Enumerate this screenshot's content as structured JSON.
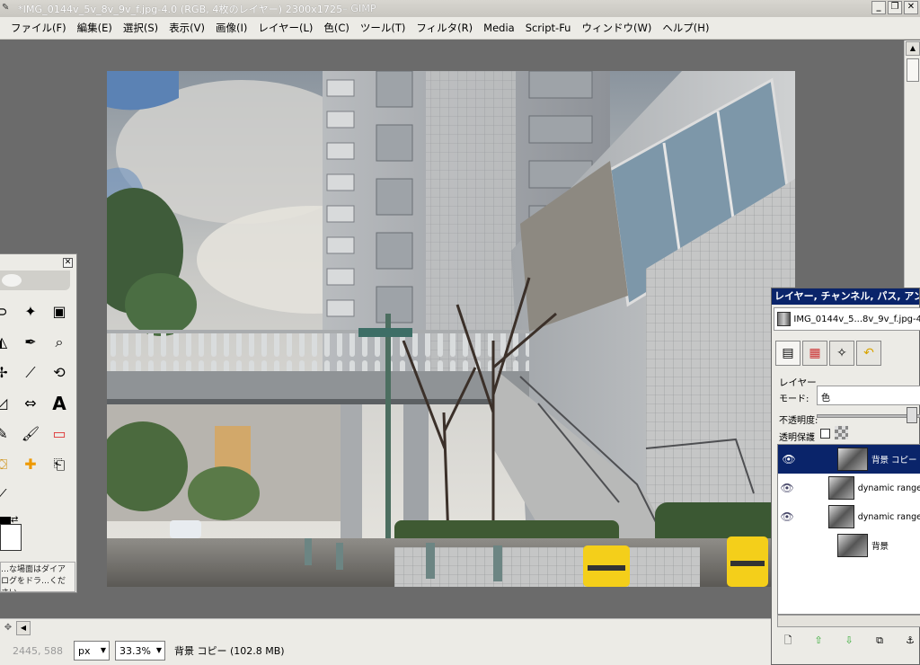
{
  "window": {
    "title_main": "*IMG_0144v_5v_8v_9v_f.jpg-4.0 (RGB, 4枚のレイヤー) 2300x1725",
    "title_suffix": " – GIMP",
    "buttons": {
      "minimize": "_",
      "maximize": "❐",
      "close": "✕"
    }
  },
  "menu": [
    "ファイル(F)",
    "編集(E)",
    "選択(S)",
    "表示(V)",
    "画像(I)",
    "レイヤー(L)",
    "色(C)",
    "ツール(T)",
    "フィルタ(R)",
    "Media",
    "Script-Fu",
    "ウィンドウ(W)",
    "ヘルプ(H)"
  ],
  "toolbox": {
    "close": "✕",
    "hint": "…な場面はダイアログをドラ…ください"
  },
  "status": {
    "coords": "2445, 588",
    "unit": "px",
    "zoom": "33.3%",
    "info": "背景 コピー (102.8 MB)"
  },
  "dock": {
    "title": "レイヤー, チャンネル, パス, アンドゥ",
    "image_name": "IMG_0144v_5...8v_9v_f.jpg-4",
    "section": "レイヤー",
    "mode_label": "モード:",
    "mode_value": "色",
    "opacity_label": "不透明度:",
    "lock_label": "透明保護",
    "layers": [
      {
        "name": "背景 コピー",
        "visible": true,
        "selected": true
      },
      {
        "name": "dynamic range",
        "visible": true,
        "selected": false
      },
      {
        "name": "dynamic range",
        "visible": true,
        "selected": false
      },
      {
        "name": "背景",
        "visible": false,
        "selected": false
      }
    ]
  }
}
